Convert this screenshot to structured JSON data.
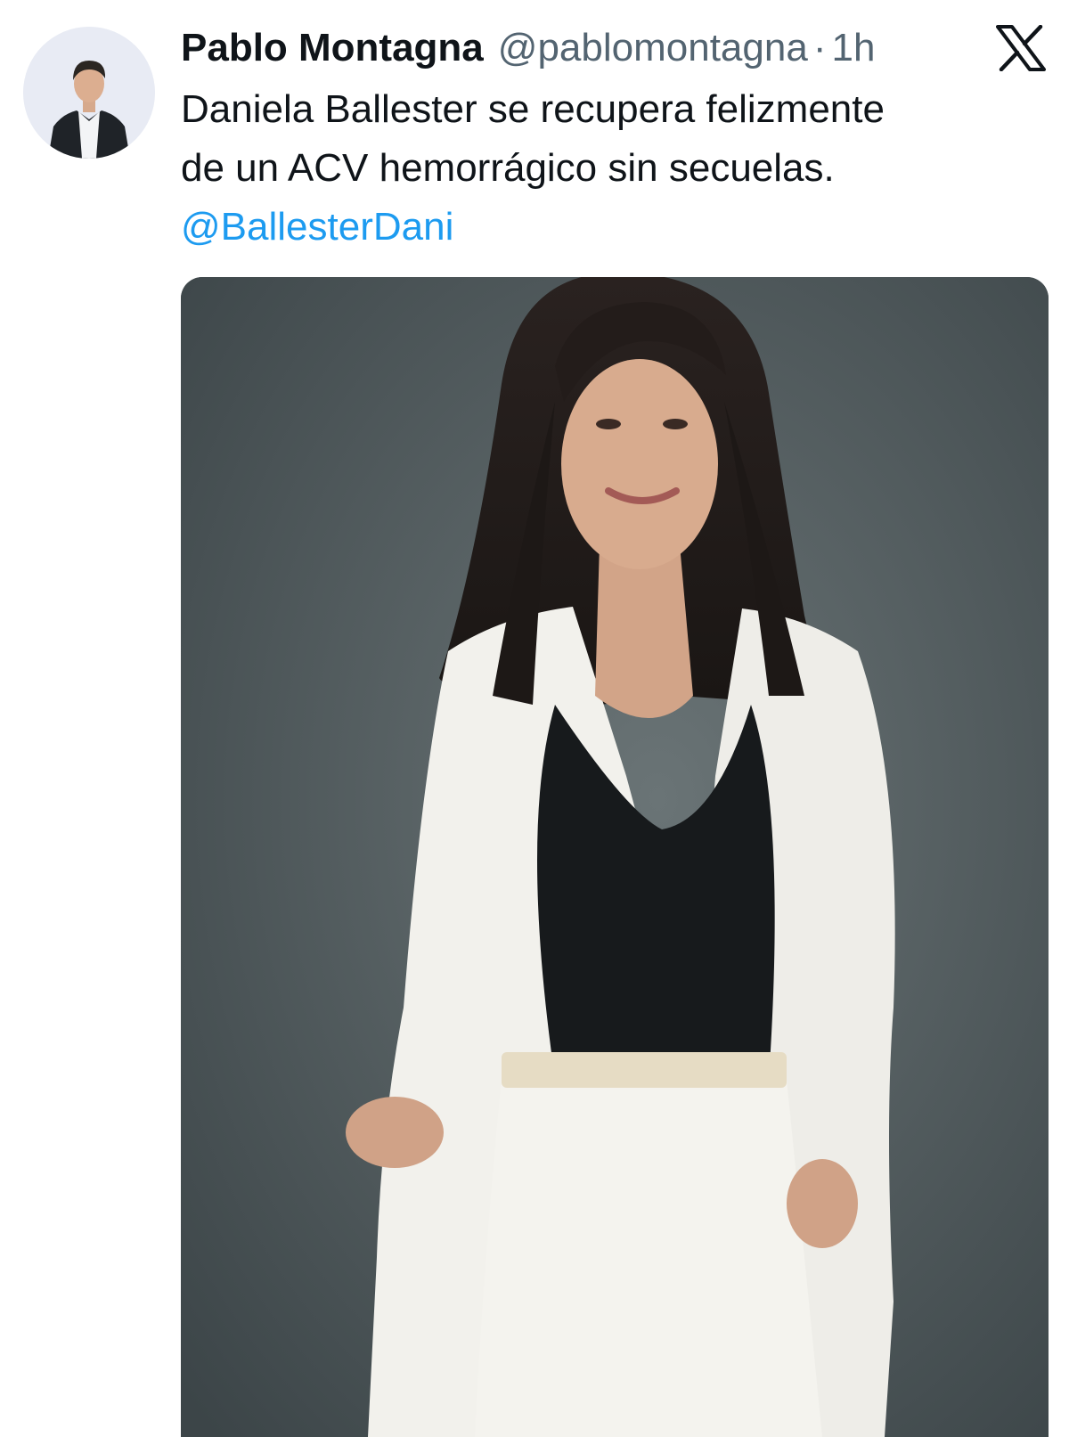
{
  "author": {
    "display_name": "Pablo Montagna",
    "handle": "@pablomontagna",
    "separator": "·",
    "timestamp": "1h",
    "avatar_icon": "profile-avatar"
  },
  "platform": {
    "logo_icon": "x-logo-icon"
  },
  "tweet": {
    "text_line1": "Daniela Ballester se recupera felizmente",
    "text_line2": "de un ACV hemorrágico sin secuelas.",
    "mention": "@BallesterDani"
  },
  "media": {
    "kind": "photo"
  },
  "colors": {
    "text": "#0f1419",
    "secondary": "#536471",
    "link": "#1d9bf0",
    "photo_background": "#4b5558"
  }
}
